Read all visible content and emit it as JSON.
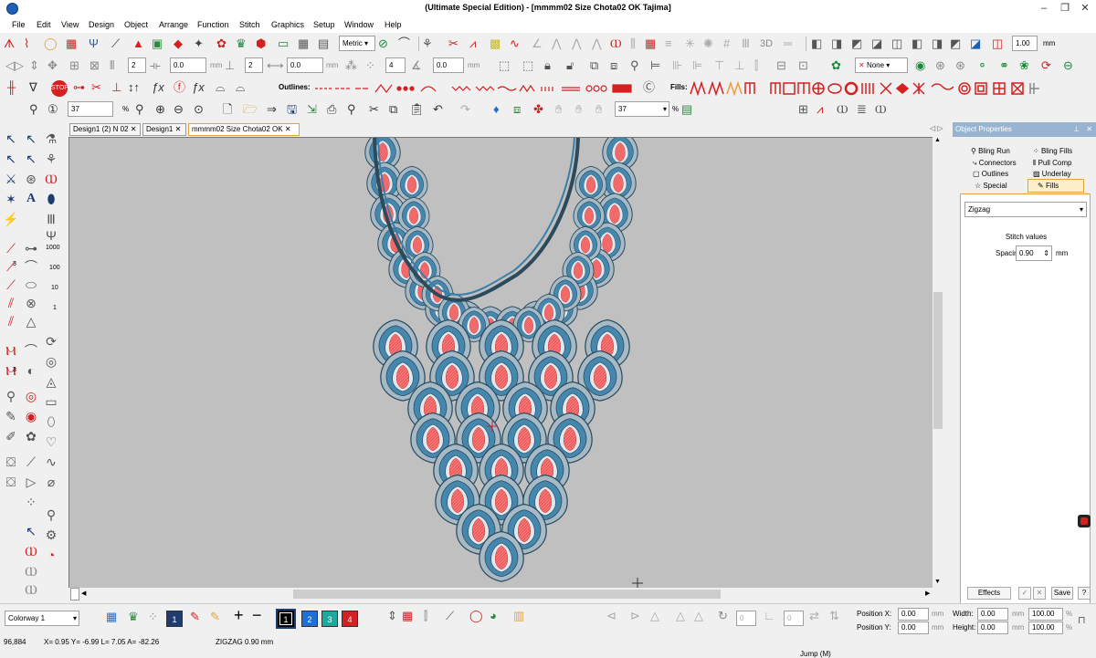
{
  "window": {
    "title": "(Ultimate Special Edition) - [mmmm02 Size Chota02 OK        Tajima]"
  },
  "menu": [
    "File",
    "Edit",
    "View",
    "Design",
    "Object",
    "Arrange",
    "Function",
    "Stitch",
    "Graphics",
    "Setup",
    "Window",
    "Help"
  ],
  "toolbar": {
    "units_value": "Metric",
    "size_value": "1.00",
    "size_unit": "mm",
    "fields_r2": [
      "2",
      "0.0",
      "mm",
      "2",
      "0.0",
      "mm",
      "4",
      "0.0",
      "mm"
    ],
    "color_none": "None",
    "outlines_label": "Outlines:",
    "fills_label": "Fills:",
    "zoom_value": "37",
    "zoom_unit": "%",
    "zoom_value_2": "37",
    "zoom_unit_2": "%",
    "digit_1": "1",
    "digit_3": "3"
  },
  "lefttools": {
    "n1000": "1000",
    "n100": "100",
    "n10": "10",
    "n1": "1",
    "n3a": "3",
    "n3b": "3"
  },
  "tabs": [
    {
      "label": "Design1 (2) N 02",
      "close": "✕"
    },
    {
      "label": "Design1",
      "close": "✕"
    },
    {
      "label": "mmmm02 Size Chota02 OK",
      "close": "✕"
    }
  ],
  "panel": {
    "title": "Object Properties",
    "tabs": [
      "Bling Run",
      "Connectors",
      "Outlines",
      "Special",
      "Bling Fills",
      "Pull Comp",
      "Underlay",
      "Fills"
    ],
    "fill_type": "Zigzag",
    "section_label": "Stitch values",
    "spacing_label": "Spacing:",
    "spacing_value": "0.90",
    "spacing_unit": "mm",
    "effects_label": "Effects",
    "save_label": "Save",
    "help_label": "?"
  },
  "statusbar": {
    "colorway": "Colorway 1",
    "color_slots": [
      "1",
      "2",
      "3",
      "4"
    ],
    "stitch_count": "96,884",
    "coords": "X=  0.95 Y=  -6.99 L=  7.05 A= -82.26",
    "stitch_type": "ZIGZAG  0.90 mm",
    "mode": "Jump (M)",
    "position_x_label": "Position X:",
    "position_x_value": "0.00",
    "position_y_label": "Position Y:",
    "position_y_value": "0.00",
    "width_label": "Width:",
    "width_value": "0.00",
    "height_label": "Height:",
    "height_value": "0.00",
    "scale_w": "100.00",
    "scale_h": "100.00",
    "unit_mm": "mm",
    "unit_pct": "%",
    "rotate_value": "0",
    "rotate_value_2": "0"
  },
  "colors": {
    "accent": "#e6a23c",
    "embroidery_blue": "#3a7fa8",
    "embroidery_red": "#f05a5a",
    "embroidery_outline": "#2d4a5c",
    "canvas_bg": "#c0c0c0"
  }
}
